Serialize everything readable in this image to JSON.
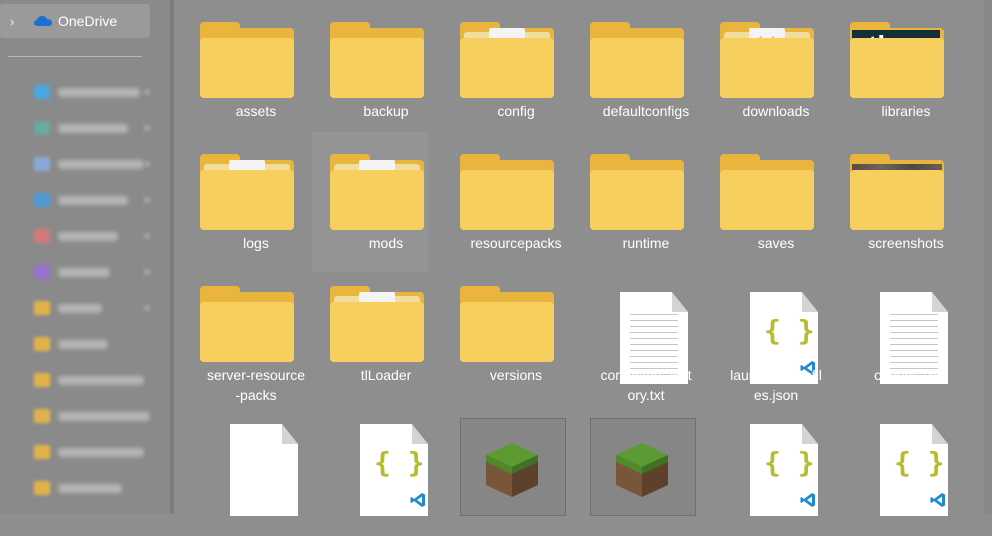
{
  "sidebar": {
    "top_item": {
      "label": "OneDrive",
      "chevron_icon": "chevron-right-icon",
      "icon": "cloud-icon"
    },
    "blurred_items": [
      {
        "icon_color": "#4aa7e3"
      },
      {
        "icon_color": "#6aa8a0"
      },
      {
        "icon_color": "#8aa9d6"
      },
      {
        "icon_color": "#4f9ad8"
      },
      {
        "icon_color": "#d07a7a"
      },
      {
        "icon_color": "#9b6fd1"
      },
      {
        "icon_color": "#e1b34a"
      },
      {
        "icon_color": "#e1b34a"
      },
      {
        "icon_color": "#e1b34a"
      },
      {
        "icon_color": "#e1b34a"
      },
      {
        "icon_color": "#e1b34a"
      },
      {
        "icon_color": "#e1b34a"
      }
    ]
  },
  "files": [
    {
      "name": "assets",
      "kind": "folder"
    },
    {
      "name": "backup",
      "kind": "folder"
    },
    {
      "name": "config",
      "kind": "folder-doc"
    },
    {
      "name": "defaultconfigs",
      "kind": "folder"
    },
    {
      "name": "downloads",
      "kind": "folder-json"
    },
    {
      "name": "libraries",
      "kind": "folder-tl"
    },
    {
      "name": "logs",
      "kind": "folder-doc"
    },
    {
      "name": "mods",
      "kind": "folder-doc",
      "selected": true
    },
    {
      "name": "resourcepacks",
      "kind": "folder"
    },
    {
      "name": "runtime",
      "kind": "folder"
    },
    {
      "name": "saves",
      "kind": "folder"
    },
    {
      "name": "screenshots",
      "kind": "folder-img"
    },
    {
      "name": "server-resource-packs",
      "kind": "folder",
      "display": [
        "server-resource",
        "-packs"
      ]
    },
    {
      "name": "tlLoader",
      "kind": "folder-doc"
    },
    {
      "name": "versions",
      "kind": "folder"
    },
    {
      "name": "command_history.txt",
      "kind": "txt",
      "display": [
        "command_hist",
        "ory.txt"
      ]
    },
    {
      "name": "launcher_profiles.json",
      "kind": "json",
      "display": [
        "launcher_profil",
        "es.json"
      ]
    },
    {
      "name": "options.txt",
      "kind": "txt"
    },
    {
      "name": "",
      "kind": "blank-doc"
    },
    {
      "name": "",
      "kind": "json"
    },
    {
      "name": "",
      "kind": "minecraft"
    },
    {
      "name": "",
      "kind": "minecraft"
    },
    {
      "name": "",
      "kind": "json"
    },
    {
      "name": "",
      "kind": "json"
    }
  ],
  "colors": {
    "folder_back": "#e9b53c",
    "folder_front": "#f7cf5f",
    "json_braces": "#b5bc2e",
    "vscode_blue": "#1f8ad2",
    "text": "#ffffff"
  }
}
